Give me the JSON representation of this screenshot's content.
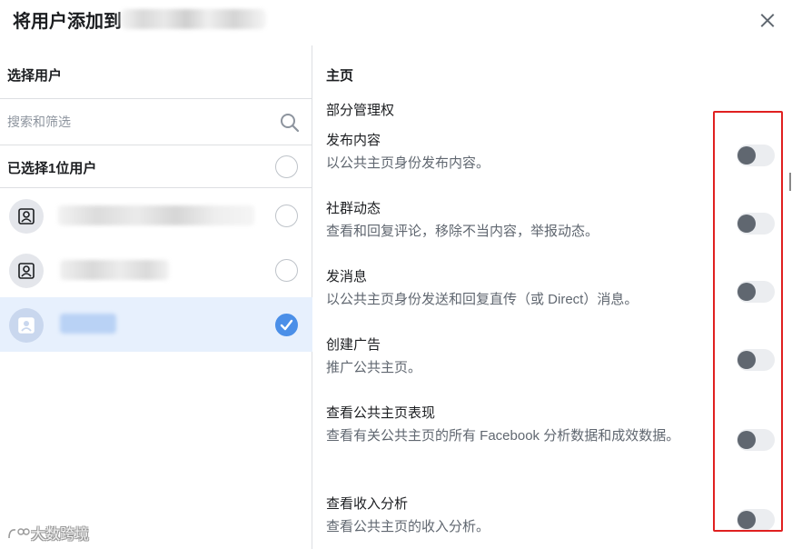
{
  "dialog": {
    "title": "将用户添加到",
    "close_icon": "close-icon"
  },
  "left": {
    "title": "选择用户",
    "search": {
      "placeholder": "搜索和筛选",
      "value": "",
      "icon": "search-icon"
    },
    "selected_label": "已选择1位用户",
    "users": [
      {
        "avatar_icon": "user-avatar-icon",
        "selected": false
      },
      {
        "avatar_icon": "user-avatar-icon",
        "selected": false
      },
      {
        "avatar_icon": "user-avatar-icon",
        "selected": true
      }
    ]
  },
  "right": {
    "section": "主页",
    "subsection": "部分管理权",
    "permissions": [
      {
        "title": "发布内容",
        "desc": "以公共主页身份发布内容。",
        "enabled": false
      },
      {
        "title": "社群动态",
        "desc": "查看和回复评论，移除不当内容，举报动态。",
        "enabled": false
      },
      {
        "title": "发消息",
        "desc": "以公共主页身份发送和回复直传（或 Direct）消息。",
        "enabled": false
      },
      {
        "title": "创建广告",
        "desc": "推广公共主页。",
        "enabled": false
      },
      {
        "title": "查看公共主页表现",
        "desc": "查看有关公共主页的所有 Facebook 分析数据和成效数据。",
        "enabled": false
      },
      {
        "title": "查看收入分析",
        "desc": "查看公共主页的收入分析。",
        "enabled": false
      }
    ]
  },
  "annotation": {
    "color": "#e02020"
  },
  "watermark": "大数跨境",
  "colors": {
    "accent": "#4b8fe8",
    "selected_row": "#e7f0fd",
    "toggle_off": "#ebedf0"
  }
}
